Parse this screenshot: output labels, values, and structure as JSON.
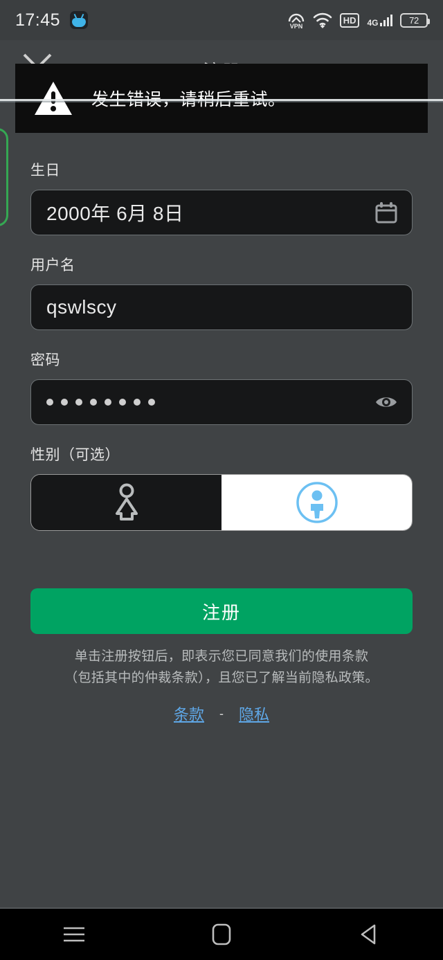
{
  "statusbar": {
    "time": "17:45",
    "app_icon": "bilibili-app-icon",
    "vpn_label": "VPN",
    "hd_label": "HD",
    "network_label": "4G",
    "battery_level": "72"
  },
  "header": {
    "title": "注册",
    "close_icon": "close-icon"
  },
  "toast": {
    "icon": "warning-triangle-icon",
    "message": "发生错误，请稍后重试。"
  },
  "form": {
    "birthday": {
      "label": "生日",
      "value": "2000年 6月 8日",
      "trailing_icon": "calendar-icon"
    },
    "username": {
      "label": "用户名",
      "value": "qswlscy",
      "placeholder": "用户名"
    },
    "password": {
      "label": "密码",
      "value": "••••••••",
      "dot_count": 8,
      "placeholder": "密码",
      "trailing_icon": "eye-icon"
    },
    "gender": {
      "label": "性别（可选）",
      "options": [
        {
          "name": "female",
          "icon": "female-person-icon",
          "selected": false
        },
        {
          "name": "male",
          "icon": "male-person-circle-icon",
          "selected": true
        }
      ]
    }
  },
  "submit": {
    "label": "注册",
    "color": "#00a362"
  },
  "legal": {
    "disclaimer": "单击注册按钮后，即表示您已同意我们的使用条款（包括其中的仲裁条款），且您已了解当前隐私政策。",
    "terms_link": "条款",
    "separator": "-",
    "privacy_link": "隐私",
    "link_color": "#5fa8e8"
  },
  "navbar": {
    "menu_icon": "menu-icon",
    "home_icon": "home-icon",
    "back_icon": "back-icon"
  }
}
